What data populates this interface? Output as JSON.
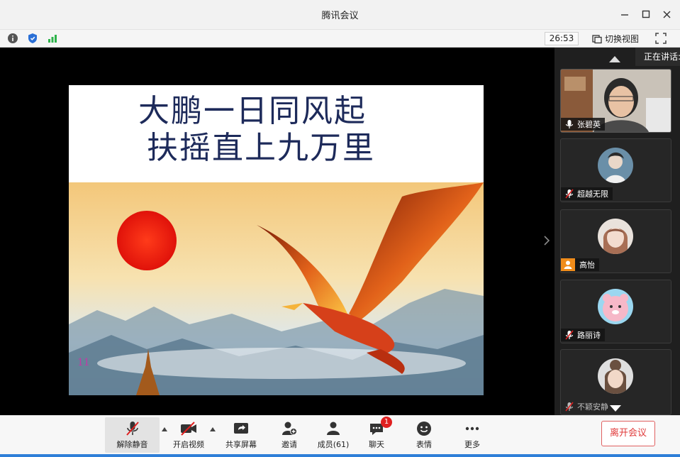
{
  "window": {
    "title": "腾讯会议"
  },
  "statusbar": {
    "timer": "26:53",
    "switch_view_label": "切换视图"
  },
  "slide": {
    "line1": "大鹏一日同风起",
    "line2": "扶摇直上九万里"
  },
  "side_panel": {
    "speaking_label": "正在讲话:",
    "participants": [
      {
        "name": "张碧英",
        "mic": "on"
      },
      {
        "name": "超越无限",
        "mic": "muted"
      },
      {
        "name": "高怡",
        "mic": "none"
      },
      {
        "name": "路丽诗",
        "mic": "muted"
      },
      {
        "name": "不颖安静",
        "mic": "muted"
      }
    ]
  },
  "toolbar": {
    "unmute_label": "解除静音",
    "video_label": "开启视频",
    "share_label": "共享屏幕",
    "invite_label": "邀请",
    "members_label": "成员(61)",
    "chat_label": "聊天",
    "chat_badge": "1",
    "emoji_label": "表情",
    "more_label": "更多",
    "leave_label": "离开会议"
  },
  "colors": {
    "accent_red": "#e03a3a",
    "toolbar_bg": "#f7f7f7",
    "stage_bg": "#000000",
    "bottom_strip": "#2f7fd8"
  }
}
